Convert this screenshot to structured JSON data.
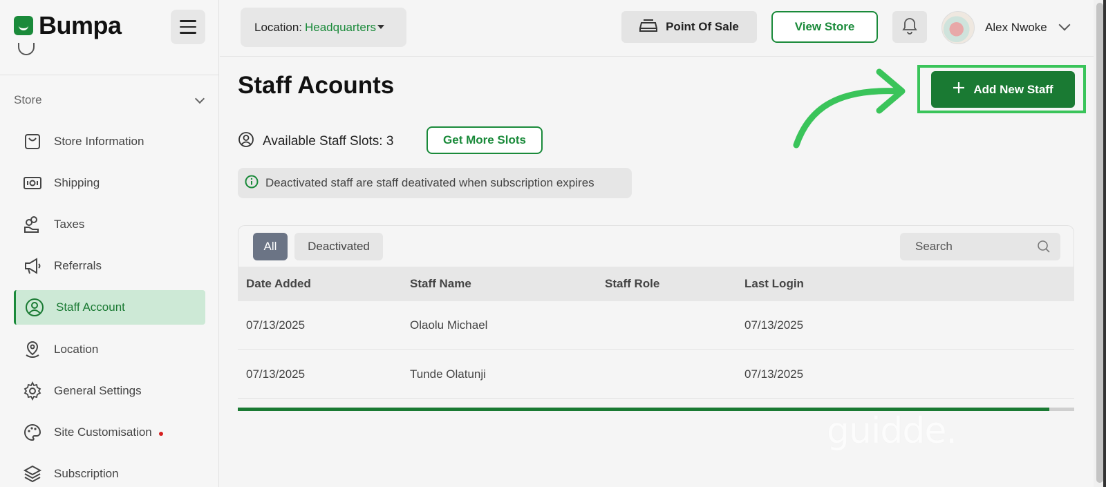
{
  "brand": {
    "name": "Bumpa",
    "color": "#1a8a3a"
  },
  "sidebar": {
    "section_label": "Store",
    "items": [
      {
        "label": "Store Information",
        "icon": "bag-icon"
      },
      {
        "label": "Shipping",
        "icon": "money-icon"
      },
      {
        "label": "Taxes",
        "icon": "coins-hand-icon"
      },
      {
        "label": "Referrals",
        "icon": "megaphone-icon"
      },
      {
        "label": "Staff Account",
        "icon": "user-circle-icon",
        "active": true
      },
      {
        "label": "Location",
        "icon": "location-pin-icon"
      },
      {
        "label": "General Settings",
        "icon": "gear-icon"
      },
      {
        "label": "Site Customisation",
        "icon": "palette-icon",
        "badge": "dot"
      },
      {
        "label": "Subscription",
        "icon": "layers-icon"
      }
    ]
  },
  "topbar": {
    "location_key": "Location:",
    "location_value": "Headquarters",
    "pos_label": "Point Of Sale",
    "view_store_label": "View Store",
    "user_name": "Alex Nwoke"
  },
  "main": {
    "title": "Staff Acounts",
    "add_button_label": "Add New Staff",
    "slots_label": "Available Staff Slots: 3",
    "get_more_label": "Get More Slots",
    "info_text": "Deactivated staff are staff deativated when subscription expires"
  },
  "table": {
    "tabs": [
      "All",
      "Deactivated"
    ],
    "search_placeholder": "Search",
    "columns": [
      "Date Added",
      "Staff Name",
      "Staff Role",
      "Last Login"
    ],
    "rows": [
      {
        "date_added": "07/13/2025",
        "staff_name": "Olaolu Michael",
        "staff_role": "",
        "last_login": "07/13/2025"
      },
      {
        "date_added": "07/13/2025",
        "staff_name": "Tunde Olatunji",
        "staff_role": "",
        "last_login": "07/13/2025"
      }
    ],
    "horizontal_scroll_fraction": 0.97
  },
  "watermark": "guidde."
}
